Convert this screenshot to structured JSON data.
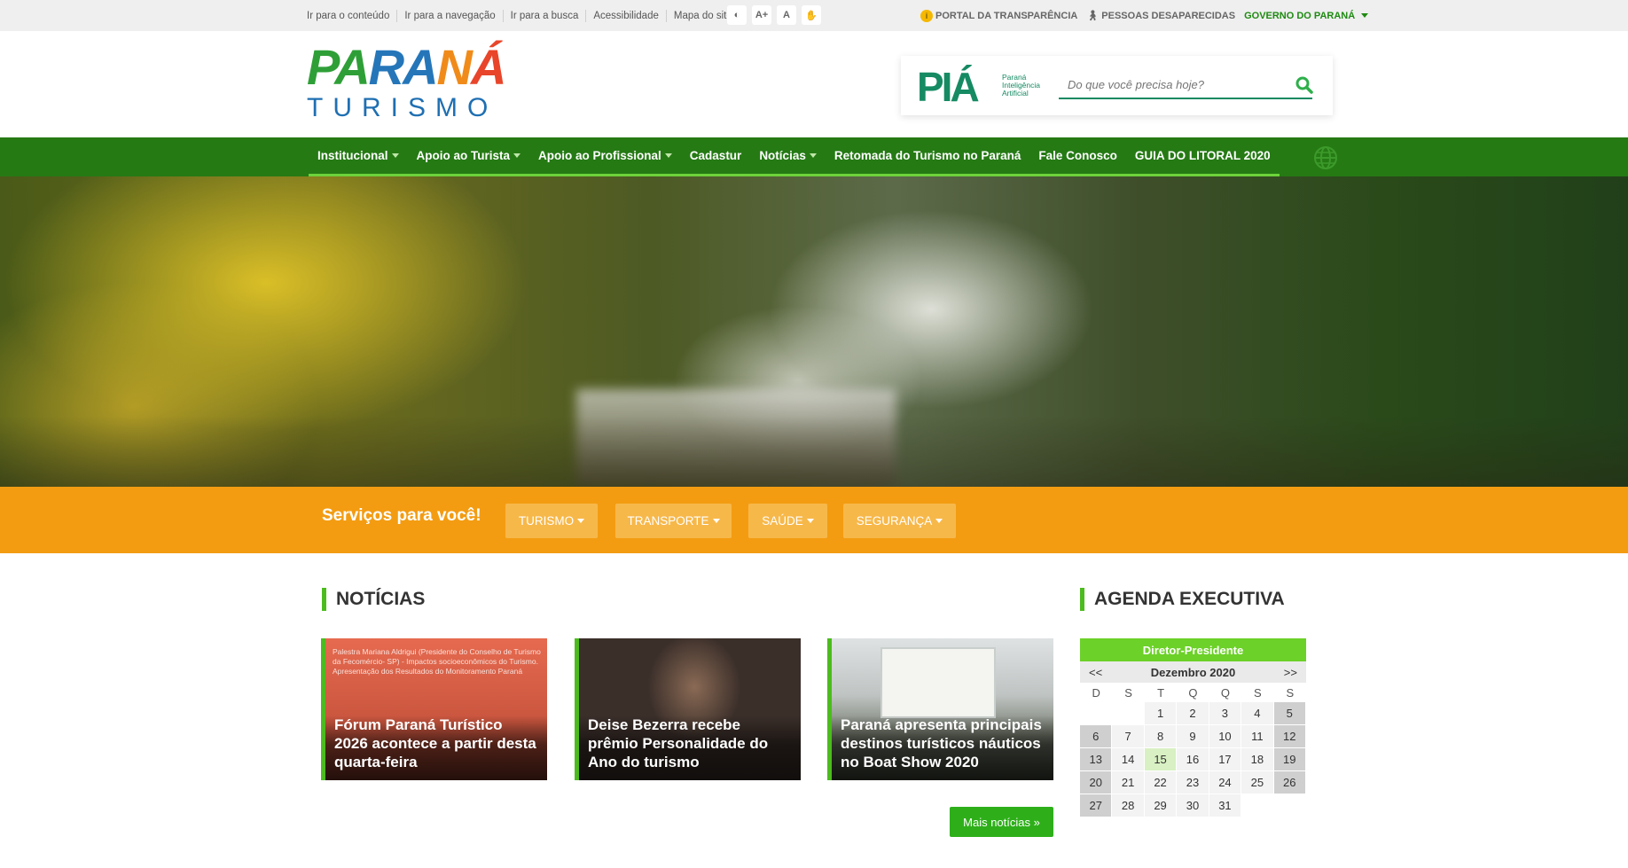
{
  "topbar": {
    "skip_links": [
      "Ir para o conteúdo",
      "Ir para a navegação",
      "Ir para a busca",
      "Acessibilidade",
      "Mapa do site"
    ],
    "tools": [
      "◐",
      "A+",
      "A",
      "✋"
    ],
    "transparency": "PORTAL DA TRANSPARÊNCIA",
    "missing": "PESSOAS DESAPARECIDAS",
    "government": "GOVERNO DO PARANÁ"
  },
  "logo": {
    "parana_p1": "PA",
    "parana_p2": "RA",
    "parana_p3": "N",
    "parana_p4": "Á",
    "turismo": "TURISMO"
  },
  "search": {
    "brand": "PIÁ",
    "brand_sub": "Paraná Inteligência Artificial",
    "placeholder": "Do que você precisa hoje?"
  },
  "nav": {
    "items": [
      {
        "label": "Institucional",
        "dropdown": true
      },
      {
        "label": "Apoio ao Turista",
        "dropdown": true
      },
      {
        "label": "Apoio ao Profissional",
        "dropdown": true
      },
      {
        "label": "Cadastur",
        "dropdown": false
      },
      {
        "label": "Notícias",
        "dropdown": true
      },
      {
        "label": "Retomada do Turismo no Paraná",
        "dropdown": false
      },
      {
        "label": "Fale Conosco",
        "dropdown": false
      },
      {
        "label": "GUIA DO LITORAL 2020",
        "dropdown": false
      }
    ]
  },
  "services": {
    "title": "Serviços para você!",
    "buttons": [
      "TURISMO",
      "TRANSPORTE",
      "SAÚDE",
      "SEGURANÇA"
    ]
  },
  "news": {
    "title": "NOTÍCIAS",
    "items": [
      {
        "headline": "Fórum Paraná Turístico 2026 acontece a partir desta quarta-feira",
        "slide_text": "Palestra Mariana Aldrigui (Presidente do Conselho de Turismo da Fecomércio- SP) - Impactos socioeconômicos do Turismo. Apresentação dos Resultados do Monitoramento Paraná"
      },
      {
        "headline": "Deise Bezerra recebe prêmio Personalidade do Ano do turismo"
      },
      {
        "headline": "Paraná apresenta principais destinos turísticos náuticos no Boat Show 2020"
      }
    ],
    "more": "Mais notícias »"
  },
  "agenda": {
    "title": "AGENDA EXECUTIVA",
    "person": "Diretor-Presidente",
    "prev": "<<",
    "next": ">>",
    "month": "Dezembro 2020",
    "day_names": [
      "D",
      "S",
      "T",
      "Q",
      "Q",
      "S",
      "S"
    ],
    "days": [
      "",
      "",
      "1",
      "2",
      "3",
      "4",
      "5",
      "6",
      "7",
      "8",
      "9",
      "10",
      "11",
      "12",
      "13",
      "14",
      "15",
      "16",
      "17",
      "18",
      "19",
      "20",
      "21",
      "22",
      "23",
      "24",
      "25",
      "26",
      "27",
      "28",
      "29",
      "30",
      "31",
      "",
      ""
    ],
    "today": "15"
  },
  "colors": {
    "nav_green": "#257a14",
    "accent_green": "#4cbb1e",
    "services_orange": "#f39c12",
    "calendar_header": "#6cd128"
  }
}
